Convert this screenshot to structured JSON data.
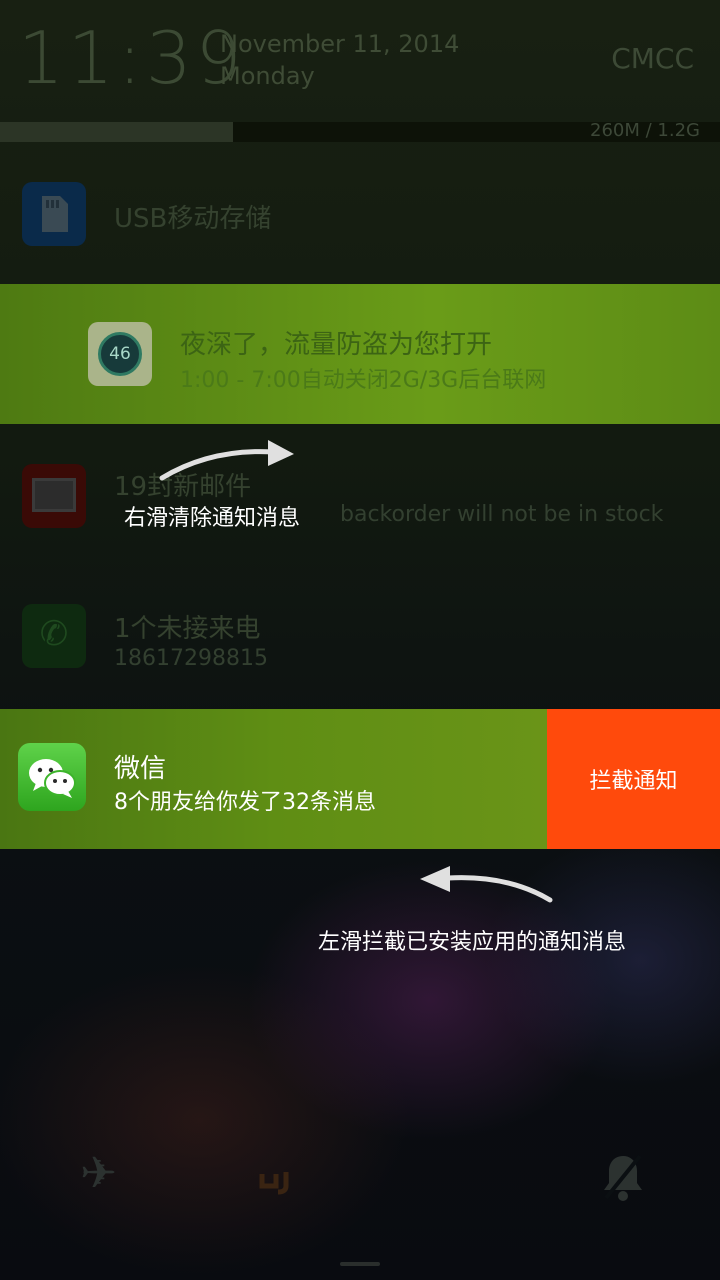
{
  "status": {
    "time": "11:39",
    "date": "November 11, 2014",
    "weekday": "Monday",
    "carrier": "CMCC",
    "memory": "260M / 1.2G",
    "memory_fraction": 0.21
  },
  "notifications": {
    "usb": {
      "title": "USB移动存储",
      "icon": "sd-card-icon"
    },
    "traffic": {
      "title": "夜深了，流量防盗为您打开",
      "subtitle": "1:00 - 7:00自动关闭2G/3G后台联网",
      "badge": "46",
      "icon": "traffic-dial-icon"
    },
    "mail": {
      "title": "19封新邮件",
      "subtitle": "backorder will not be in stock",
      "icon": "mail-icon"
    },
    "call": {
      "title": "1个未接来电",
      "subtitle": "18617298815",
      "icon": "phone-icon"
    },
    "wechat": {
      "title": "微信",
      "subtitle": "8个朋友给你发了32条消息",
      "icon": "wechat-icon",
      "action_label": "拦截通知"
    }
  },
  "hints": {
    "swipe_right": "右滑清除通知消息",
    "swipe_left": "左滑拦截已安装应用的通知消息"
  },
  "toggles": [
    {
      "name": "airplane-mode",
      "icon": "airplane-icon"
    },
    {
      "name": "data",
      "icon": "data-icon"
    },
    {
      "name": "silent",
      "icon": "bell-off-icon"
    }
  ],
  "colors": {
    "accent_green": "#6a9c18",
    "block_orange": "#ff4a0c",
    "wechat_green": "#2ea51e"
  }
}
